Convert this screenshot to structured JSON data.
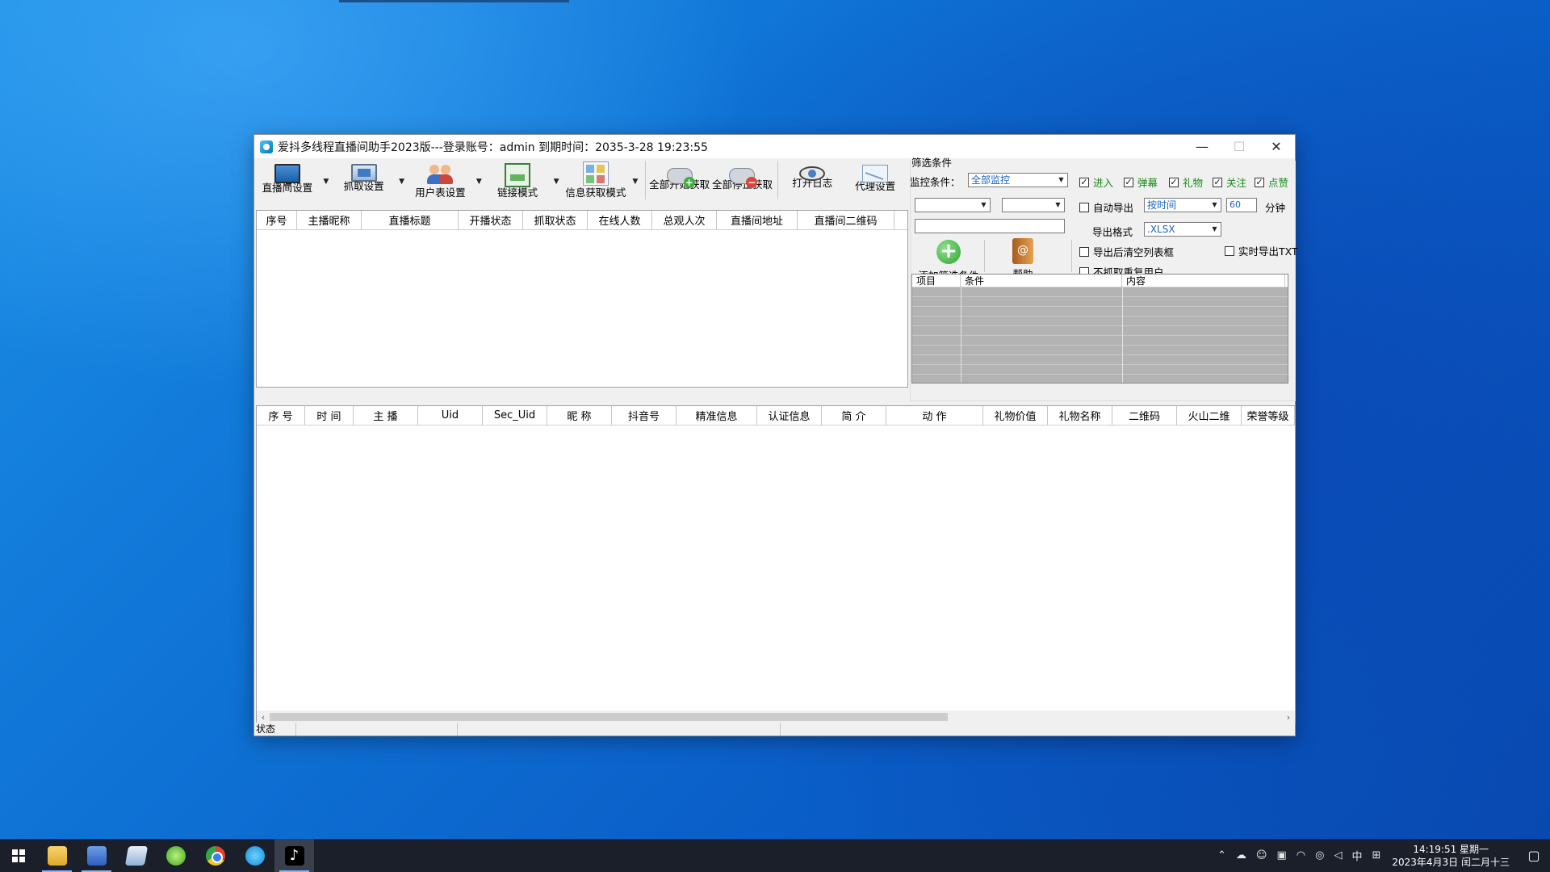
{
  "window": {
    "title": "爱抖多线程直播间助手2023版---登录账号：admin  到期时间：2035-3-28 19:23:55"
  },
  "toolbar": {
    "items": [
      {
        "label": "直播间设置",
        "icon": "tv-icon"
      },
      {
        "label": "抓取设置",
        "icon": "monitor-icon"
      },
      {
        "label": "用户表设置",
        "icon": "users-icon"
      },
      {
        "label": "链接模式",
        "icon": "link-mode-icon"
      },
      {
        "label": "信息获取模式",
        "icon": "grid-icon"
      },
      {
        "label": "全部开始获取",
        "icon": "gamepad-start-icon"
      },
      {
        "label": "全部停止获取",
        "icon": "gamepad-stop-icon"
      },
      {
        "label": "打开日志",
        "icon": "eye-icon"
      },
      {
        "label": "代理设置",
        "icon": "mail-icon"
      }
    ]
  },
  "room_table": {
    "columns": [
      "序号",
      "主播昵称",
      "直播标题",
      "开播状态",
      "抓取状态",
      "在线人数",
      "总观人次",
      "直播间地址",
      "直播间二维码"
    ]
  },
  "filter": {
    "legend": "筛选条件",
    "monitor_label": "监控条件：",
    "monitor_value": "全部监控",
    "checks": [
      {
        "label": "进入",
        "checked": true
      },
      {
        "label": "弹幕",
        "checked": true
      },
      {
        "label": "礼物",
        "checked": true
      },
      {
        "label": "关注",
        "checked": true
      },
      {
        "label": "点赞",
        "checked": true
      }
    ],
    "auto_export_label": "自动导出",
    "auto_export_mode": "按时间",
    "interval_value": "60",
    "interval_unit": "分钟",
    "export_format_label": "导出格式",
    "export_format_value": ".XLSX",
    "clear_after_export": "导出后清空列表框",
    "realtime_export_txt": "实时导出TXT",
    "no_duplicate_users": "不抓取重复用户",
    "add_button": "添加筛选条件",
    "help_button": "帮助",
    "cond_columns": [
      "项目",
      "条件",
      "内容"
    ]
  },
  "user_table": {
    "columns": [
      "序  号",
      "时 间",
      "主 播",
      "Uid",
      "Sec_Uid",
      "昵 称",
      "抖音号",
      "精准信息",
      "认证信息",
      "简 介",
      "动 作",
      "礼物价值",
      "礼物名称",
      "二维码",
      "火山二维",
      "荣誉等级"
    ]
  },
  "statusbar": {
    "label": "状态"
  },
  "taskbar": {
    "time": "14:19:51 星期一",
    "date": "2023年4月3日 闰二月十三",
    "ime": "中",
    "apps": [
      "file-explorer-icon",
      "this-pc-icon",
      "notepad-icon",
      "green-browser-icon",
      "chrome-icon",
      "blue-app-icon",
      "tiktok-icon"
    ]
  }
}
